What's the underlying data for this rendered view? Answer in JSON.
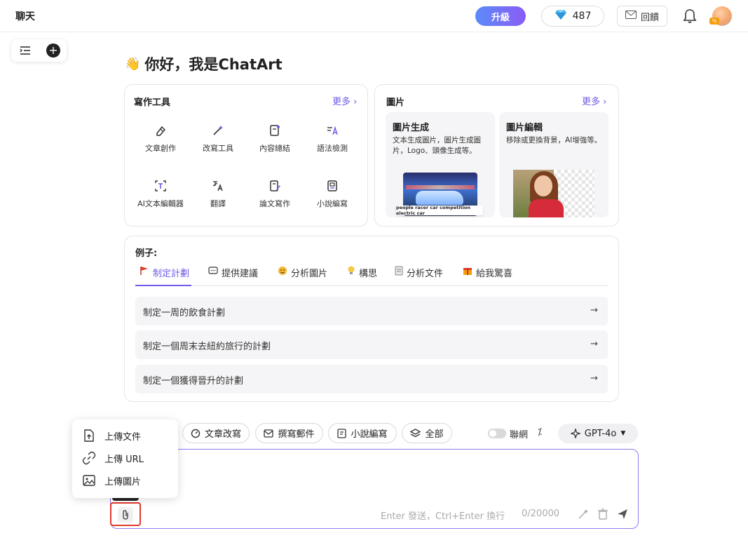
{
  "header": {
    "title": "聊天",
    "upgrade_label": "升級",
    "gems": "487",
    "feedback_label": "回饋"
  },
  "greeting": {
    "emoji": "👋",
    "text": "你好，我是ChatArt"
  },
  "writing_tools": {
    "title": "寫作工具",
    "more": "更多 ›",
    "items": [
      {
        "label": "文章創作",
        "icon": "eraser-pen-icon"
      },
      {
        "label": "改寫工具",
        "icon": "magic-wand-icon"
      },
      {
        "label": "內容總結",
        "icon": "summary-icon"
      },
      {
        "label": "語法檢測",
        "icon": "grammar-icon"
      },
      {
        "label": "AI文本編輯器",
        "icon": "text-editor-icon"
      },
      {
        "label": "翻譯",
        "icon": "translate-icon"
      },
      {
        "label": "論文寫作",
        "icon": "paper-write-icon"
      },
      {
        "label": "小說編寫",
        "icon": "novel-icon"
      }
    ]
  },
  "images": {
    "title": "圖片",
    "more": "更多 ›",
    "tiles": [
      {
        "title": "圖片生成",
        "desc": "文本生成圖片，圖片生成圖片，Logo、頭像生成等。",
        "caption": "people racer car competition electric car"
      },
      {
        "title": "圖片編輯",
        "desc": "移除或更換背景，AI增強等。"
      }
    ]
  },
  "examples": {
    "title": "例子:",
    "tabs": [
      {
        "label": "制定計劃",
        "icon": "flag-icon"
      },
      {
        "label": "提供建議",
        "icon": "chat-bubble-icon"
      },
      {
        "label": "分析圖片",
        "icon": "face-icon"
      },
      {
        "label": "構思",
        "icon": "lightbulb-icon"
      },
      {
        "label": "分析文件",
        "icon": "document-icon"
      },
      {
        "label": "給我驚喜",
        "icon": "gift-icon"
      }
    ],
    "items": [
      "制定一周的飲食計劃",
      "制定一個周末去紐約旅行的計劃",
      "制定一個獲得晉升的計劃"
    ]
  },
  "quick_actions": {
    "buttons": [
      {
        "label": "文章改寫",
        "icon": "rewrite-icon"
      },
      {
        "label": "撰寫郵件",
        "icon": "mail-icon"
      },
      {
        "label": "小說編寫",
        "icon": "novel-icon"
      },
      {
        "label": "全部",
        "icon": "layers-icon"
      }
    ],
    "web_toggle_label": "聯網",
    "model": "GPT-4o"
  },
  "input": {
    "hint": "Enter 發送，Ctrl+Enter 換行",
    "count": "0/20000"
  },
  "upload_menu": {
    "items": [
      {
        "label": "上傳文件",
        "icon": "file-upload-icon"
      },
      {
        "label": "上傳 URL",
        "icon": "link-icon"
      },
      {
        "label": "上傳圖片",
        "icon": "image-icon"
      }
    ]
  },
  "colors": {
    "accent": "#6d5ce8",
    "highlight_border": "#e0392b"
  }
}
